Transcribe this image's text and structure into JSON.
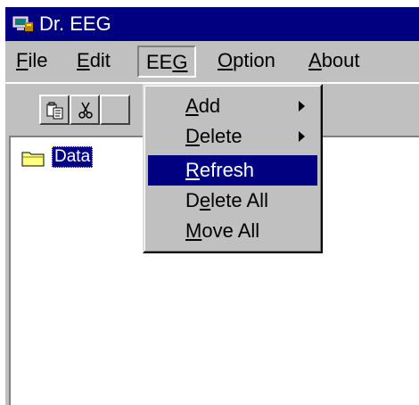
{
  "window": {
    "title": "Dr. EEG"
  },
  "menubar": {
    "items": [
      {
        "label": "File",
        "mnemonic": "F",
        "rest": "ile"
      },
      {
        "label": "Edit",
        "mnemonic": "E",
        "rest": "dit"
      },
      {
        "label": "EEG",
        "pre": "EE",
        "mnemonic": "G"
      },
      {
        "label": "Option",
        "mnemonic": "O",
        "rest": "ption"
      },
      {
        "label": "About",
        "mnemonic": "A",
        "rest": "bout"
      }
    ]
  },
  "toolbar": {
    "buttons": [
      {
        "icon": "paste-icon"
      },
      {
        "icon": "cut-icon"
      }
    ]
  },
  "eeg_menu": {
    "items": [
      {
        "label": "Add",
        "mnemonic": "A",
        "rest": "dd",
        "submenu": true
      },
      {
        "label": "Delete",
        "mnemonic": "D",
        "rest": "elete",
        "submenu": true
      },
      {
        "label": "Refresh",
        "mnemonic": "R",
        "rest": "efresh",
        "selected": true
      },
      {
        "label": "Delete All",
        "pre": "D",
        "mnemonic": "e",
        "rest": "lete All"
      },
      {
        "label": "Move All",
        "mnemonic": "M",
        "rest": "ove All"
      }
    ]
  },
  "tree": {
    "root_label": "Data"
  },
  "colors": {
    "title_bar": "#000080",
    "selection": "#000080",
    "face": "#c0c0c0"
  }
}
